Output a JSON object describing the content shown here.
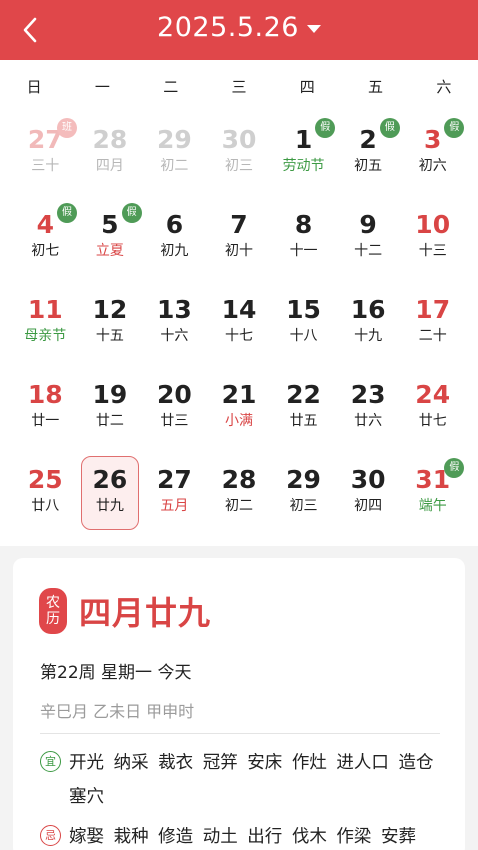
{
  "header": {
    "title": "2025.5.26"
  },
  "weekdays": [
    "日",
    "一",
    "二",
    "三",
    "四",
    "五",
    "六"
  ],
  "days": [
    {
      "num": "27",
      "sub": "三十",
      "badge": "班"
    },
    {
      "num": "28",
      "sub": "四月"
    },
    {
      "num": "29",
      "sub": "初二"
    },
    {
      "num": "30",
      "sub": "初三"
    },
    {
      "num": "1",
      "sub": "劳动节",
      "badge": "假"
    },
    {
      "num": "2",
      "sub": "初五",
      "badge": "假"
    },
    {
      "num": "3",
      "sub": "初六",
      "badge": "假"
    },
    {
      "num": "4",
      "sub": "初七",
      "badge": "假"
    },
    {
      "num": "5",
      "sub": "立夏",
      "badge": "假"
    },
    {
      "num": "6",
      "sub": "初九"
    },
    {
      "num": "7",
      "sub": "初十"
    },
    {
      "num": "8",
      "sub": "十一"
    },
    {
      "num": "9",
      "sub": "十二"
    },
    {
      "num": "10",
      "sub": "十三"
    },
    {
      "num": "11",
      "sub": "母亲节"
    },
    {
      "num": "12",
      "sub": "十五"
    },
    {
      "num": "13",
      "sub": "十六"
    },
    {
      "num": "14",
      "sub": "十七"
    },
    {
      "num": "15",
      "sub": "十八"
    },
    {
      "num": "16",
      "sub": "十九"
    },
    {
      "num": "17",
      "sub": "二十"
    },
    {
      "num": "18",
      "sub": "廿一"
    },
    {
      "num": "19",
      "sub": "廿二"
    },
    {
      "num": "20",
      "sub": "廿三"
    },
    {
      "num": "21",
      "sub": "小满"
    },
    {
      "num": "22",
      "sub": "廿五"
    },
    {
      "num": "23",
      "sub": "廿六"
    },
    {
      "num": "24",
      "sub": "廿七"
    },
    {
      "num": "25",
      "sub": "廿八"
    },
    {
      "num": "26",
      "sub": "廿九"
    },
    {
      "num": "27",
      "sub": "五月"
    },
    {
      "num": "28",
      "sub": "初二"
    },
    {
      "num": "29",
      "sub": "初三"
    },
    {
      "num": "30",
      "sub": "初四"
    },
    {
      "num": "31",
      "sub": "端午",
      "badge": "假"
    }
  ],
  "detail": {
    "lunar_tag_1": "农",
    "lunar_tag_2": "历",
    "lunar_date": "四月廿九",
    "week_info": "第22周 星期一 今天",
    "ganzhi": "辛巳月 乙未日 甲申时",
    "yi_label": "宜",
    "yi_items": "开光 纳采 裁衣 冠笄 安床 作灶 进人口 造仓 塞穴",
    "ji_label": "忌",
    "ji_items": "嫁娶 栽种 修造 动土 出行 伐木 作梁 安葬"
  }
}
